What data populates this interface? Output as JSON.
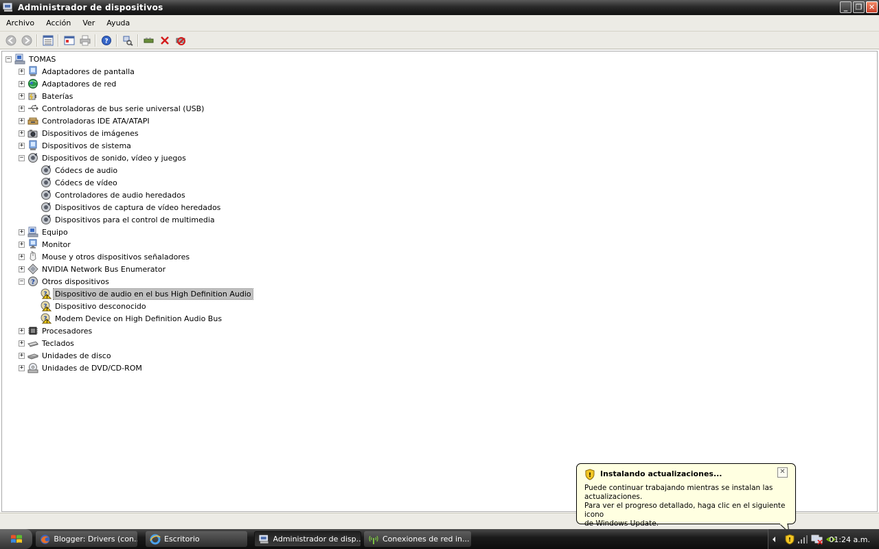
{
  "window": {
    "title": "Administrador de dispositivos",
    "minimize": "_",
    "maximize": "❐",
    "close": "✕"
  },
  "menu": [
    "Archivo",
    "Acción",
    "Ver",
    "Ayuda"
  ],
  "toolbar": {
    "icons": [
      "back-icon",
      "forward-icon",
      "tree-view-icon",
      "properties-icon",
      "print-icon",
      "help-icon",
      "scan-hardware-icon",
      "update-driver-icon",
      "uninstall-icon",
      "disable-icon"
    ]
  },
  "tree": {
    "expand_glyph": "+",
    "collapse_glyph": "−",
    "root": "TOMAS",
    "nodes": [
      {
        "label": "Adaptadores de pantalla",
        "expander": "+",
        "icon": "display-adapter-icon"
      },
      {
        "label": "Adaptadores de red",
        "expander": "+",
        "icon": "network-adapter-icon"
      },
      {
        "label": "Baterías",
        "expander": "+",
        "icon": "battery-icon"
      },
      {
        "label": "Controladoras de bus serie universal (USB)",
        "expander": "+",
        "icon": "usb-icon"
      },
      {
        "label": "Controladoras IDE ATA/ATAPI",
        "expander": "+",
        "icon": "ide-controller-icon"
      },
      {
        "label": "Dispositivos de imágenes",
        "expander": "+",
        "icon": "camera-icon"
      },
      {
        "label": "Dispositivos de sistema",
        "expander": "+",
        "icon": "system-device-icon"
      },
      {
        "label": "Dispositivos de sonido, vídeo y juegos",
        "expander": "−",
        "icon": "sound-icon",
        "children": [
          {
            "label": "Códecs de audio",
            "icon": "sound-icon"
          },
          {
            "label": "Códecs de vídeo",
            "icon": "sound-icon"
          },
          {
            "label": "Controladores de audio heredados",
            "icon": "sound-icon"
          },
          {
            "label": "Dispositivos de captura de vídeo heredados",
            "icon": "sound-icon"
          },
          {
            "label": "Dispositivos para el control de multimedia",
            "icon": "sound-icon"
          }
        ]
      },
      {
        "label": "Equipo",
        "expander": "+",
        "icon": "computer-icon"
      },
      {
        "label": "Monitor",
        "expander": "+",
        "icon": "monitor-icon"
      },
      {
        "label": "Mouse y otros dispositivos señaladores",
        "expander": "+",
        "icon": "mouse-icon"
      },
      {
        "label": "NVIDIA Network Bus Enumerator",
        "expander": "+",
        "icon": "nvidia-bus-icon"
      },
      {
        "label": "Otros dispositivos",
        "expander": "−",
        "icon": "unknown-device-icon",
        "children": [
          {
            "label": "Dispositivo de audio en el bus High Definition Audio",
            "icon": "warning-device-icon",
            "selected": true
          },
          {
            "label": "Dispositivo desconocido",
            "icon": "warning-device-icon"
          },
          {
            "label": "Modem Device on High Definition Audio Bus",
            "icon": "warning-device-icon"
          }
        ]
      },
      {
        "label": "Procesadores",
        "expander": "+",
        "icon": "processor-icon"
      },
      {
        "label": "Teclados",
        "expander": "+",
        "icon": "keyboard-icon"
      },
      {
        "label": "Unidades de disco",
        "expander": "+",
        "icon": "disk-drive-icon"
      },
      {
        "label": "Unidades de DVD/CD-ROM",
        "expander": "+",
        "icon": "dvd-drive-icon"
      }
    ]
  },
  "balloon": {
    "title": "Instalando actualizaciones...",
    "close": "✕",
    "lines": [
      "Puede continuar trabajando mientras se instalan las",
      "actualizaciones.",
      "Para ver el progreso detallado, haga clic en el siguiente icono",
      "de Windows Update."
    ]
  },
  "taskbar": {
    "tasks": [
      {
        "label": "Blogger: Drivers (con...",
        "icon": "firefox-icon",
        "active": false
      },
      {
        "label": "Escritorio",
        "icon": "ie-icon",
        "active": false
      },
      {
        "label": "Administrador de disp...",
        "icon": "device-manager-icon",
        "active": true
      },
      {
        "label": "Conexiones de red in...",
        "icon": "wireless-icon",
        "active": false
      }
    ],
    "clock": "01:24 a.m."
  },
  "colors": {
    "selection": "#c0c0c0",
    "balloon_bg": "#ffffe1",
    "titlebar": "#2a2a2a"
  }
}
